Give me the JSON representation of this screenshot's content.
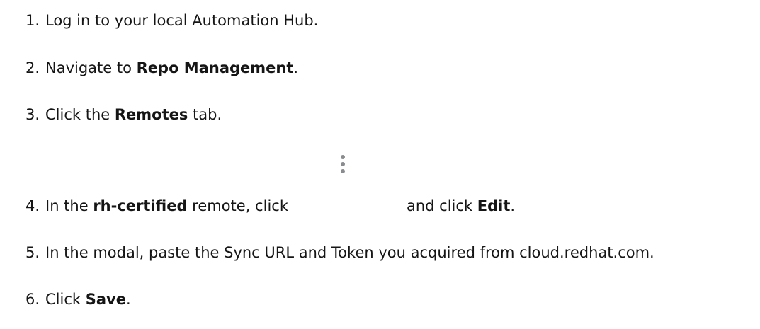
{
  "steps": [
    {
      "number": "1.",
      "text_before": "Log in to your local Automation Hub."
    },
    {
      "number": "2.",
      "text_before": "Navigate to ",
      "bold": "Repo Management",
      "text_after": "."
    },
    {
      "number": "3.",
      "text_before": "Click the ",
      "bold": "Remotes",
      "text_after": " tab."
    },
    {
      "number": "4.",
      "text_before": "In the ",
      "bold": "rh-certified",
      "text_middle": " remote, click",
      "icon": "kebab-menu-icon",
      "text_after_icon": "and click ",
      "bold2": "Edit",
      "text_after": "."
    },
    {
      "number": "5.",
      "text_before": "In the modal, paste the Sync URL and Token you acquired from cloud.redhat.com."
    },
    {
      "number": "6.",
      "text_before": "Click ",
      "bold": "Save",
      "text_after": "."
    }
  ]
}
